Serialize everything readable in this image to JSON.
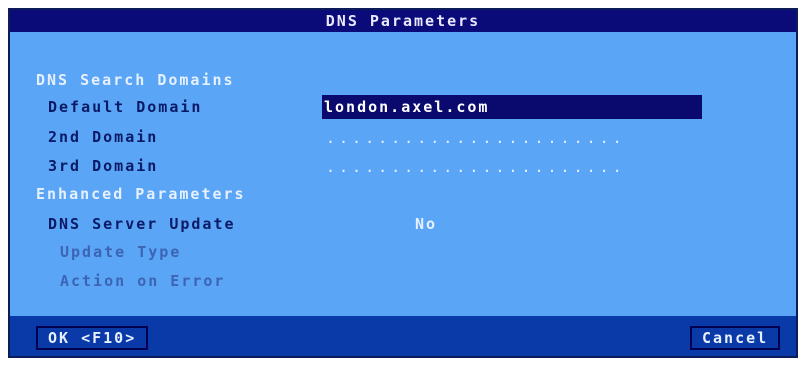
{
  "dialog": {
    "title": "DNS Parameters",
    "sections": {
      "search_domains": "DNS Search Domains",
      "enhanced": "Enhanced Parameters"
    },
    "fields": {
      "default_domain": {
        "label": "Default Domain",
        "value": "london.axel.com"
      },
      "second_domain": {
        "label": "2nd Domain",
        "value": "......................."
      },
      "third_domain": {
        "label": "3rd Domain",
        "value": "......................."
      },
      "dns_server_update": {
        "label": "DNS Server Update",
        "value": "No"
      },
      "update_type": {
        "label": "Update Type"
      },
      "action_on_error": {
        "label": "Action on Error"
      }
    },
    "buttons": {
      "ok": "OK <F10>",
      "cancel": "Cancel"
    }
  },
  "colors": {
    "background": "#5aa5f5",
    "titlebar": "#0a0a78",
    "footer": "#0a3aa8",
    "active_field": "#0a0a6e"
  }
}
